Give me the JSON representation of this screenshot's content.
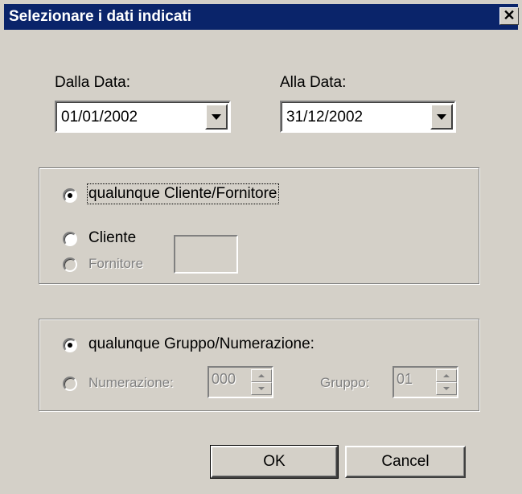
{
  "window": {
    "title": "Selezionare i dati indicati",
    "close_glyph": "✕"
  },
  "dates": {
    "from_label": "Dalla Data:",
    "from_value": "01/01/2002",
    "to_label": "Alla Data:",
    "to_value": "31/12/2002"
  },
  "party_group": {
    "any_label": "qualunque Cliente/Fornitore",
    "any_checked": true,
    "cliente_label": "Cliente",
    "fornitore_label": "Fornitore",
    "code_value": ""
  },
  "numbering_group": {
    "any_label": "qualunque Gruppo/Numerazione:",
    "any_checked": true,
    "numerazione_label": "Numerazione:",
    "numerazione_value": "000",
    "gruppo_label": "Gruppo:",
    "gruppo_value": "01"
  },
  "buttons": {
    "ok_label": "OK",
    "cancel_label": "Cancel"
  },
  "icons": {
    "close": "close-icon",
    "dropdown": "chevron-down-icon",
    "spin_up": "spin-up-icon",
    "spin_down": "spin-down-icon"
  }
}
